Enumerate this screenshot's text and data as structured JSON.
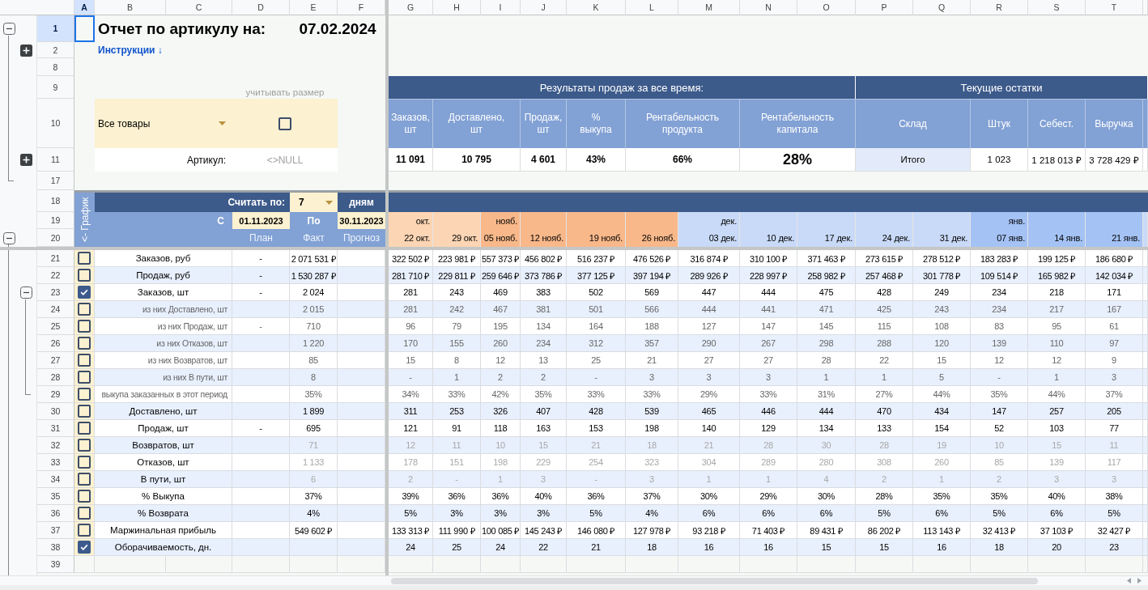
{
  "column_headers": [
    {
      "label": "A",
      "selected": true
    },
    {
      "label": "B",
      "selected": false
    },
    {
      "label": "C",
      "selected": false
    },
    {
      "label": "D",
      "selected": false
    },
    {
      "label": "E",
      "selected": false
    },
    {
      "label": "F",
      "selected": false
    },
    {
      "label": "G",
      "selected": false
    },
    {
      "label": "H",
      "selected": false
    },
    {
      "label": "I",
      "selected": false
    },
    {
      "label": "J",
      "selected": false
    },
    {
      "label": "K",
      "selected": false
    },
    {
      "label": "L",
      "selected": false
    },
    {
      "label": "M",
      "selected": false
    },
    {
      "label": "N",
      "selected": false
    },
    {
      "label": "O",
      "selected": false
    },
    {
      "label": "P",
      "selected": false
    },
    {
      "label": "Q",
      "selected": false
    },
    {
      "label": "R",
      "selected": false
    },
    {
      "label": "S",
      "selected": false
    },
    {
      "label": "T",
      "selected": false
    }
  ],
  "row_headers": [
    {
      "label": "1",
      "selected": true,
      "expanded": true,
      "children": [
        {
          "label": "2",
          "selected": false,
          "expanded": false
        },
        {
          "label": "8",
          "selected": false
        },
        {
          "label": "9",
          "selected": false
        },
        {
          "label": "10",
          "selected": false
        },
        {
          "label": "11",
          "selected": false,
          "expanded": false
        },
        {
          "label": "17",
          "selected": false
        }
      ]
    },
    {
      "label": "18",
      "selected": false
    },
    {
      "label": "19",
      "selected": false
    },
    {
      "label": "20",
      "selected": false,
      "expanded": true,
      "children": [
        {
          "label": "21",
          "selected": false
        },
        {
          "label": "22",
          "selected": false
        },
        {
          "label": "23",
          "selected": false,
          "expanded": true,
          "children": [
            {
              "label": "24",
              "selected": false
            },
            {
              "label": "25",
              "selected": false
            },
            {
              "label": "26",
              "selected": false
            },
            {
              "label": "27",
              "selected": false
            },
            {
              "label": "28",
              "selected": false
            },
            {
              "label": "29",
              "selected": false
            }
          ]
        },
        {
          "label": "30",
          "selected": false
        },
        {
          "label": "31",
          "selected": false
        },
        {
          "label": "32",
          "selected": false
        },
        {
          "label": "33",
          "selected": false
        },
        {
          "label": "34",
          "selected": false
        },
        {
          "label": "35",
          "selected": false
        },
        {
          "label": "36",
          "selected": false
        },
        {
          "label": "37",
          "selected": false
        },
        {
          "label": "38",
          "selected": false
        },
        {
          "label": "39",
          "selected": false
        }
      ]
    }
  ],
  "report": {
    "title": "Отчет по артикулу на:",
    "date": "07.02.2024",
    "instructions_link": "Инструкции ↓"
  },
  "filters": {
    "product_dropdown": {
      "value": "Все товары"
    },
    "size_checkbox": {
      "label": "учитывать размер",
      "checked": false
    },
    "article": {
      "label": "Артикул:",
      "value": "<>NULL"
    }
  },
  "sales_summary": {
    "title": "Результаты продаж за все время:",
    "columns": [
      {
        "label": "Заказов, шт",
        "value": "11 091",
        "kind": "normal"
      },
      {
        "label": "Доставлено, шт",
        "value": "10 795",
        "kind": "normal"
      },
      {
        "label": "Продаж, шт",
        "value": "4 601",
        "kind": "normal"
      },
      {
        "label": "% выкупа",
        "value": "43%",
        "kind": "normal"
      },
      {
        "label": "Рентабельность продукта",
        "value": "66%",
        "kind": "normal"
      },
      {
        "label": "Рентабельность капитала",
        "value": "28%",
        "kind": "large"
      }
    ]
  },
  "current_stock": {
    "title": "Текущие остатки",
    "columns": [
      {
        "label": "Склад",
        "value": "Итого",
        "kind": "total"
      },
      {
        "label": "Штук",
        "value": "1 023",
        "kind": "number"
      },
      {
        "label": "Себест.",
        "value": "1 218 013 ₽",
        "kind": "number"
      },
      {
        "label": "Выручка",
        "value": "3 728 429 ₽",
        "kind": "number"
      }
    ]
  },
  "period": {
    "chart_link": "<- График",
    "count_by_label": "Считать по:",
    "days_dropdown": {
      "value": "7"
    },
    "days_unit": "дням",
    "from_label": "С",
    "from_date": "01.11.2023",
    "to_label": "По",
    "to_date": "30.11.2023"
  },
  "metrics": {
    "columns": [
      "План",
      "Факт",
      "Прогноз"
    ],
    "weeks": [
      {
        "month": "окт.",
        "label": "22 окт.",
        "color": "#fcd5b4"
      },
      {
        "label": "29 окт.",
        "color": "#fcd5b4"
      },
      {
        "month": "нояб.",
        "label": "05 нояб.",
        "color": "#f8b88a"
      },
      {
        "label": "12 нояб.",
        "color": "#f8b88a"
      },
      {
        "label": "19 нояб.",
        "color": "#f8b88a"
      },
      {
        "label": "26 нояб.",
        "color": "#f8b88a"
      },
      {
        "month": "дек.",
        "label": "03 дек.",
        "color": "#c9daf8"
      },
      {
        "label": "10 дек.",
        "color": "#c9daf8"
      },
      {
        "label": "17 дек.",
        "color": "#c9daf8"
      },
      {
        "label": "24 дек.",
        "color": "#c9daf8"
      },
      {
        "label": "31 дек.",
        "color": "#c9daf8"
      },
      {
        "month": "янв.",
        "label": "07 янв.",
        "color": "#a4c2f4"
      },
      {
        "label": "14 янв.",
        "color": "#a4c2f4"
      },
      {
        "label": "21 янв.",
        "color": "#a4c2f4"
      }
    ],
    "rows": [
      {
        "label": "Заказов, руб",
        "kind": "main",
        "checked": false,
        "plan": "-",
        "fact": "2 071 531 ₽",
        "values": [
          "322 502 ₽",
          "223 981 ₽",
          "557 373 ₽",
          "456 802 ₽",
          "516 237 ₽",
          "476 526 ₽",
          "316 874 ₽",
          "310 100 ₽",
          "371 463 ₽",
          "273 615 ₽",
          "278 512 ₽",
          "183 283 ₽",
          "199 125 ₽",
          "186 680 ₽"
        ]
      },
      {
        "label": "Продаж, руб",
        "kind": "main",
        "checked": false,
        "plan": "-",
        "fact": "1 530 287 ₽",
        "values": [
          "281 710 ₽",
          "229 811 ₽",
          "259 646 ₽",
          "373 786 ₽",
          "377 125 ₽",
          "397 194 ₽",
          "289 926 ₽",
          "228 997 ₽",
          "258 982 ₽",
          "257 468 ₽",
          "301 778 ₽",
          "109 514 ₽",
          "165 982 ₽",
          "142 034 ₽"
        ]
      },
      {
        "label": "Заказов, шт",
        "kind": "main",
        "checked": true,
        "plan": "-",
        "fact": "2 024",
        "values": [
          "281",
          "243",
          "469",
          "383",
          "502",
          "569",
          "447",
          "444",
          "475",
          "428",
          "249",
          "234",
          "218",
          "171"
        ]
      },
      {
        "label": "из них Доставлено, шт",
        "kind": "sub",
        "checked": false,
        "fact": "2 015",
        "values": [
          "281",
          "242",
          "467",
          "381",
          "501",
          "566",
          "444",
          "441",
          "471",
          "425",
          "243",
          "234",
          "217",
          "167"
        ]
      },
      {
        "label": "из них Продаж, шт",
        "kind": "sub",
        "checked": false,
        "plan": "-",
        "fact": "710",
        "values": [
          "96",
          "79",
          "195",
          "134",
          "164",
          "188",
          "127",
          "147",
          "145",
          "115",
          "108",
          "83",
          "95",
          "61"
        ]
      },
      {
        "label": "из них Отказов, шт",
        "kind": "sub",
        "checked": false,
        "fact": "1 220",
        "values": [
          "170",
          "155",
          "260",
          "234",
          "312",
          "357",
          "290",
          "267",
          "298",
          "288",
          "120",
          "139",
          "110",
          "97"
        ]
      },
      {
        "label": "из них Возвратов, шт",
        "kind": "sub",
        "checked": false,
        "fact": "85",
        "values": [
          "15",
          "8",
          "12",
          "13",
          "25",
          "21",
          "27",
          "27",
          "28",
          "22",
          "15",
          "12",
          "12",
          "9"
        ]
      },
      {
        "label": "из них В пути, шт",
        "kind": "sub",
        "checked": false,
        "fact": "8",
        "values": [
          "-",
          "1",
          "2",
          "2",
          "-",
          "3",
          "3",
          "3",
          "1",
          "1",
          "5",
          "-",
          "1",
          "3"
        ]
      },
      {
        "label": "выкупа заказанных в этот период",
        "kind": "sub",
        "checked": false,
        "fact": "35%",
        "values": [
          "34%",
          "33%",
          "42%",
          "35%",
          "33%",
          "33%",
          "29%",
          "33%",
          "31%",
          "27%",
          "44%",
          "35%",
          "44%",
          "37%"
        ]
      },
      {
        "label": "Доставлено, шт",
        "kind": "main",
        "checked": false,
        "fact": "1 899",
        "values": [
          "311",
          "253",
          "326",
          "407",
          "428",
          "539",
          "465",
          "446",
          "444",
          "470",
          "434",
          "147",
          "257",
          "205"
        ]
      },
      {
        "label": "Продаж, шт",
        "kind": "main",
        "checked": false,
        "plan": "-",
        "fact": "695",
        "values": [
          "121",
          "91",
          "118",
          "163",
          "153",
          "198",
          "140",
          "129",
          "134",
          "133",
          "154",
          "52",
          "103",
          "77"
        ]
      },
      {
        "label": "Возвратов, шт",
        "kind": "faint",
        "checked": false,
        "fact": "71",
        "values": [
          "12",
          "11",
          "10",
          "15",
          "21",
          "18",
          "21",
          "28",
          "30",
          "28",
          "19",
          "10",
          "15",
          "11"
        ]
      },
      {
        "label": "Отказов, шт",
        "kind": "faint",
        "checked": false,
        "fact": "1 133",
        "values": [
          "178",
          "151",
          "198",
          "229",
          "254",
          "323",
          "304",
          "289",
          "280",
          "308",
          "260",
          "85",
          "139",
          "117"
        ]
      },
      {
        "label": "В пути, шт",
        "kind": "faint",
        "checked": false,
        "fact": "6",
        "values": [
          "2",
          "-",
          "1",
          "3",
          "-",
          "3",
          "1",
          "1",
          "4",
          "2",
          "1",
          "2",
          "3",
          "3"
        ]
      },
      {
        "label": "% Выкупа",
        "kind": "main",
        "checked": false,
        "fact": "37%",
        "values": [
          "39%",
          "36%",
          "36%",
          "40%",
          "36%",
          "37%",
          "30%",
          "29%",
          "30%",
          "28%",
          "35%",
          "35%",
          "40%",
          "38%"
        ]
      },
      {
        "label": "% Возврата",
        "kind": "main",
        "checked": false,
        "fact": "4%",
        "values": [
          "5%",
          "3%",
          "3%",
          "3%",
          "5%",
          "4%",
          "6%",
          "6%",
          "6%",
          "5%",
          "6%",
          "5%",
          "6%",
          "5%"
        ]
      },
      {
        "label": "Маржинальная прибыль",
        "kind": "main",
        "checked": false,
        "fact": "549 602 ₽",
        "values": [
          "133 313 ₽",
          "111 990 ₽",
          "100 085 ₽",
          "145 243 ₽",
          "146 080 ₽",
          "127 978 ₽",
          "93 218 ₽",
          "71 403 ₽",
          "89 431 ₽",
          "86 202 ₽",
          "113 143 ₽",
          "32 413 ₽",
          "37 103 ₽",
          "32 427 ₽"
        ]
      },
      {
        "label": "Оборачиваемость, дн.",
        "kind": "main",
        "checked": true,
        "values": [
          "24",
          "25",
          "24",
          "22",
          "21",
          "18",
          "16",
          "16",
          "15",
          "15",
          "16",
          "18",
          "20",
          "23"
        ]
      }
    ]
  }
}
